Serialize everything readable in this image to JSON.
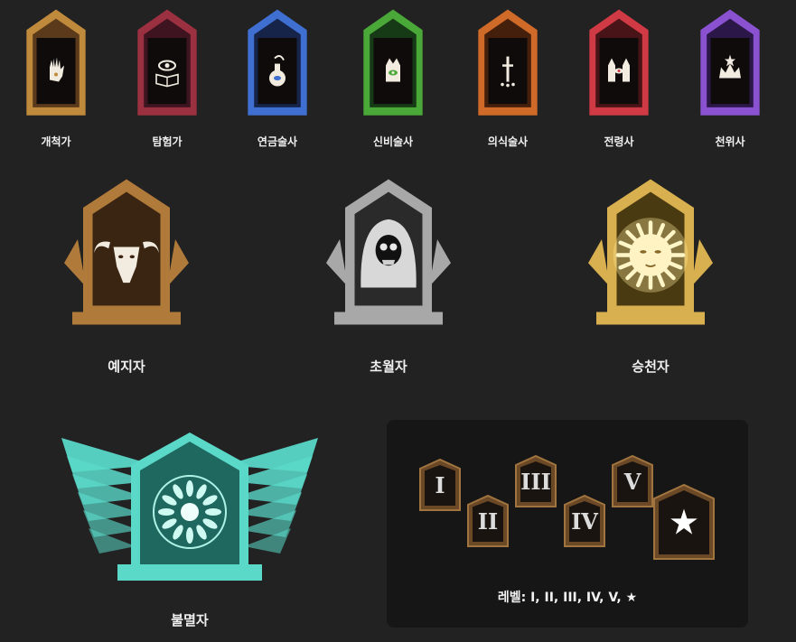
{
  "classes_small": [
    {
      "name": "개척가",
      "color": "#c08a3c",
      "glow": "#5a3a1a",
      "icon": "hand-icon"
    },
    {
      "name": "탐험가",
      "color": "#9b3040",
      "glow": "#3e1420",
      "icon": "eye-book-icon"
    },
    {
      "name": "연금술사",
      "color": "#3f6fd0",
      "glow": "#16244a",
      "icon": "flask-icon"
    },
    {
      "name": "신비술사",
      "color": "#4aa838",
      "glow": "#173a16",
      "icon": "eye-hand-icon"
    },
    {
      "name": "의식술사",
      "color": "#d06a28",
      "glow": "#44200c",
      "icon": "dagger-icon"
    },
    {
      "name": "전령사",
      "color": "#d03a44",
      "glow": "#481418",
      "icon": "eye-hands-icon"
    },
    {
      "name": "천위사",
      "color": "#8a52d0",
      "glow": "#2c1848",
      "icon": "crown-icon"
    }
  ],
  "classes_large": [
    {
      "name": "예지자",
      "color": "#b07a3a",
      "glow": "#3a2412",
      "icon": "goat-icon"
    },
    {
      "name": "초월자",
      "color": "#a8a8a8",
      "glow": "#2a2a2a",
      "icon": "skull-icon"
    },
    {
      "name": "승천자",
      "color": "#d8b050",
      "glow": "#4a3a12",
      "icon": "sun-face-icon"
    }
  ],
  "class_immortal": {
    "name": "불멸자",
    "color": "#5ad8c8",
    "glow": "#1e6860",
    "icon": "mandala-icon"
  },
  "levels": {
    "items": [
      "I",
      "II",
      "III",
      "IV",
      "V",
      "★"
    ],
    "caption": "레벨: I, II, III, IV, V, ★"
  }
}
